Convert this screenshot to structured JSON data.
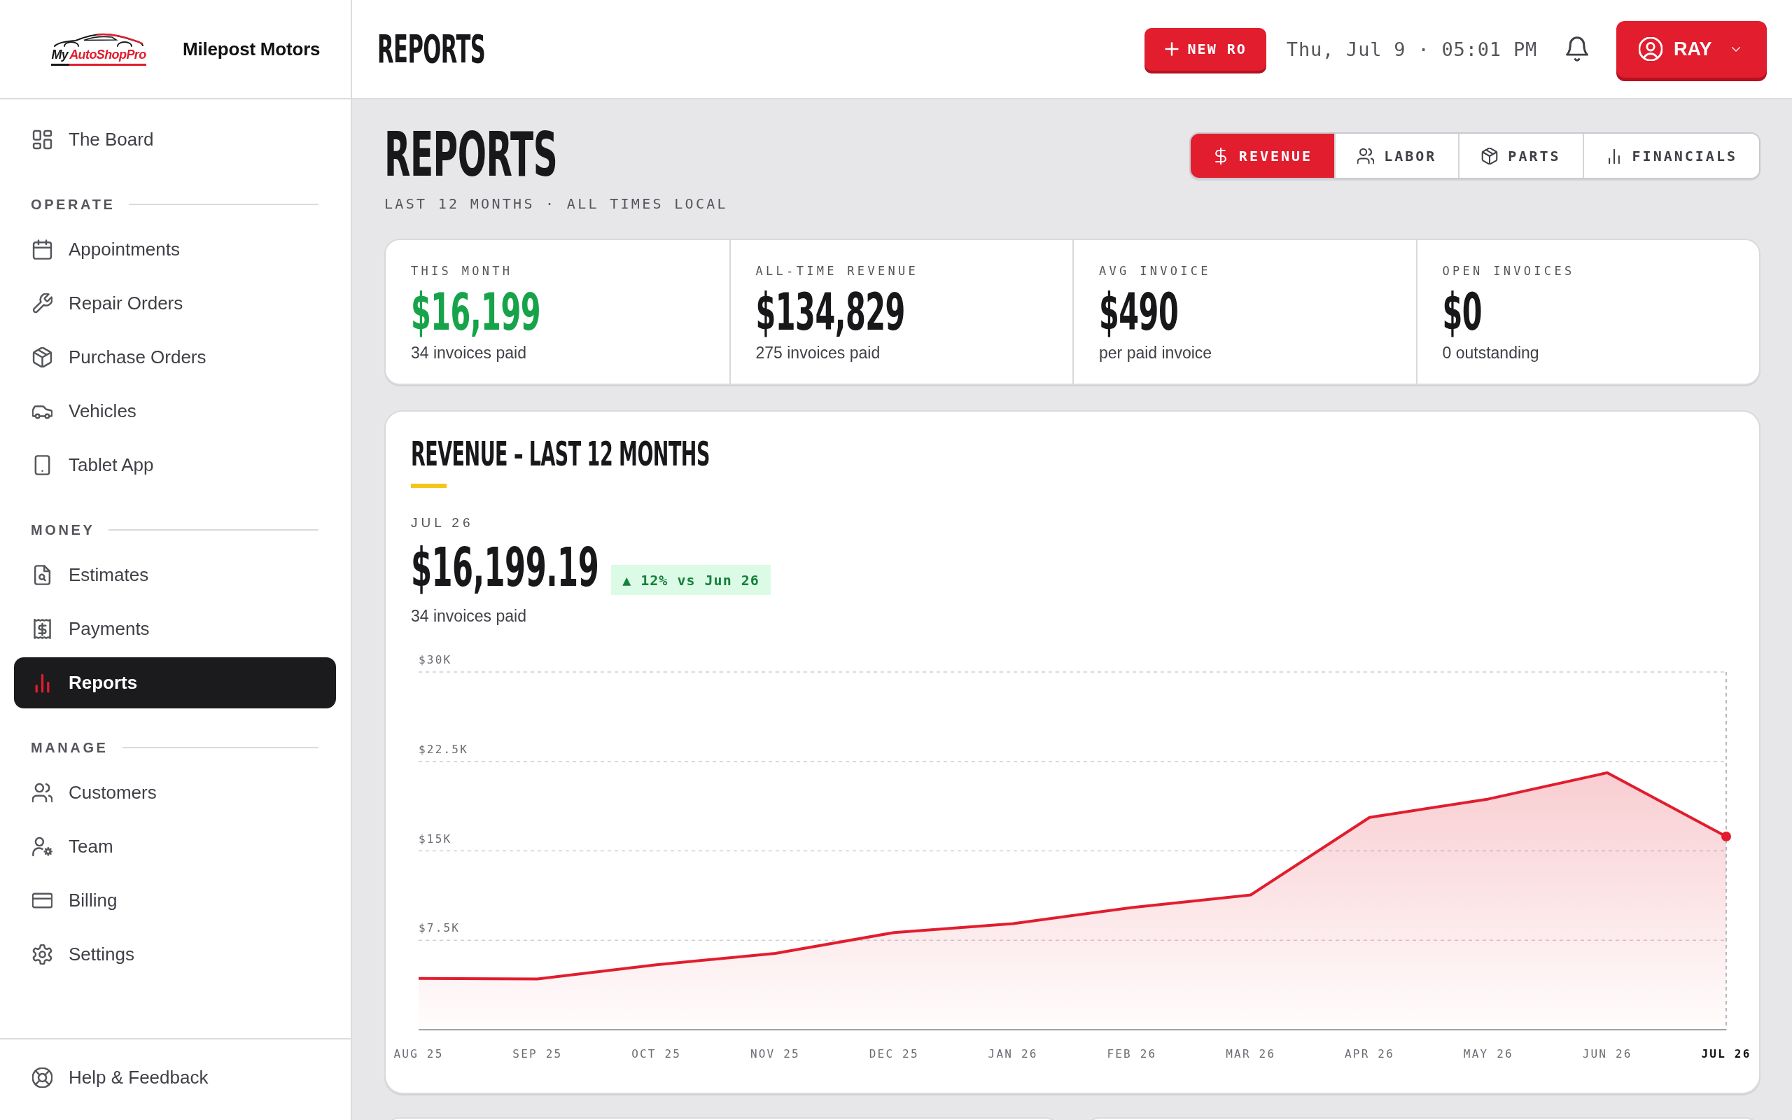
{
  "brand": {
    "wordmark_prefix": "My",
    "wordmark_rest": "AutoShopPro",
    "shop_name": "Milepost Motors"
  },
  "sidebar": {
    "top_items": [
      {
        "label": "The Board",
        "selected": false
      }
    ],
    "sections": [
      {
        "title": "OPERATE",
        "items": [
          {
            "label": "Appointments",
            "selected": false
          },
          {
            "label": "Repair Orders",
            "selected": false
          },
          {
            "label": "Purchase Orders",
            "selected": false
          },
          {
            "label": "Vehicles",
            "selected": false
          },
          {
            "label": "Tablet App",
            "selected": false
          }
        ]
      },
      {
        "title": "MONEY",
        "items": [
          {
            "label": "Estimates",
            "selected": false
          },
          {
            "label": "Payments",
            "selected": false
          },
          {
            "label": "Reports",
            "selected": true
          }
        ]
      },
      {
        "title": "MANAGE",
        "items": [
          {
            "label": "Customers",
            "selected": false
          },
          {
            "label": "Team",
            "selected": false
          },
          {
            "label": "Billing",
            "selected": false
          },
          {
            "label": "Settings",
            "selected": false
          }
        ]
      }
    ],
    "footer_item": {
      "label": "Help & Feedback",
      "selected": false
    }
  },
  "topbar": {
    "title": "REPORTS",
    "new_button": "NEW RO",
    "datetime": "Thu, Jul 9 · 05:01 PM",
    "user_button": "RAY"
  },
  "page": {
    "title": "REPORTS",
    "subtitle": "LAST 12 MONTHS · ALL TIMES LOCAL",
    "tabs": [
      {
        "label": "REVENUE",
        "selected": true
      },
      {
        "label": "LABOR",
        "selected": false
      },
      {
        "label": "PARTS",
        "selected": false
      },
      {
        "label": "FINANCIALS",
        "selected": false
      }
    ]
  },
  "stats": [
    {
      "label": "THIS MONTH",
      "value": "$16,199",
      "note": "34 invoices paid",
      "color": "#17a34a"
    },
    {
      "label": "ALL-TIME REVENUE",
      "value": "$134,829",
      "note": "275 invoices paid",
      "color": "#18181b"
    },
    {
      "label": "AVG INVOICE",
      "value": "$490",
      "note": "per paid invoice",
      "color": "#18181b"
    },
    {
      "label": "OPEN INVOICES",
      "value": "$0",
      "note": "0 outstanding",
      "color": "#18181b"
    }
  ],
  "revenue": {
    "title": "REVENUE – LAST 12 MONTHS",
    "period": "JUL 26",
    "amount": "$16,199.19",
    "change": "▲ 12% vs Jun 26",
    "note": "34 invoices paid",
    "chart_data": {
      "type": "area",
      "categories": [
        "AUG 25",
        "SEP 25",
        "OCT 25",
        "NOV 25",
        "DEC 25",
        "JAN 26",
        "FEB 26",
        "MAR 26",
        "APR 26",
        "MAY 26",
        "JUN 26",
        "JUL 26"
      ],
      "series": [
        {
          "color": "#e11d2e",
          "values": [
            4300,
            4250,
            5450,
            6400,
            8150,
            8900,
            10250,
            11300,
            17800,
            19350,
            21550,
            16200
          ]
        }
      ],
      "ylim": [
        0,
        30000
      ],
      "yticks": [
        {
          "value": 7500,
          "label": "$7.5K"
        },
        {
          "value": 15000,
          "label": "$15K"
        },
        {
          "value": 22500,
          "label": "$22.5K"
        },
        {
          "value": 30000,
          "label": "$30K"
        }
      ],
      "grid": true
    }
  }
}
